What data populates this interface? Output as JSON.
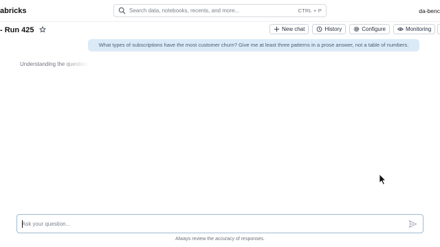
{
  "header": {
    "brand": "abricks",
    "search_placeholder": "Search data, notebooks, recents, and more...",
    "search_shortcut": "CTRL + P",
    "workspace": "da-benc"
  },
  "page": {
    "title": "- Run 425",
    "actions": {
      "new_chat": "New chat",
      "history": "History",
      "configure": "Configure",
      "monitoring": "Monitoring"
    }
  },
  "chat": {
    "user_message": "What types of subscriptions have the most customer churn? Give me at least three patterns in a prose answer, not a table of numbers.",
    "status": "Understanding the question"
  },
  "composer": {
    "placeholder": "Ask your question...",
    "value": "",
    "disclaimer": "Always review the accuracy of responses."
  },
  "colors": {
    "user_bubble": "#dbeaf7",
    "composer_border": "#9fb9cf",
    "button_border": "#cfd3d9"
  },
  "icons": [
    "search-icon",
    "star-icon",
    "plus-icon",
    "history-icon",
    "gear-icon",
    "eye-icon",
    "send-icon",
    "mouse-cursor-icon"
  ]
}
